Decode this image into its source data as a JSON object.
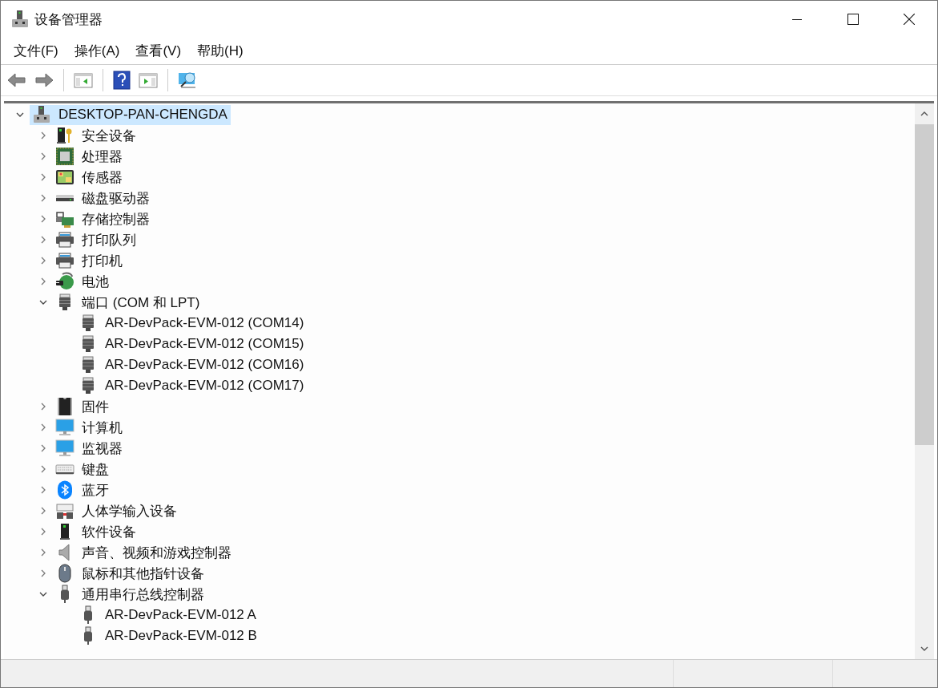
{
  "window": {
    "title": "设备管理器"
  },
  "menu": [
    {
      "label": "文件(F)"
    },
    {
      "label": "操作(A)"
    },
    {
      "label": "查看(V)"
    },
    {
      "label": "帮助(H)"
    }
  ],
  "toolbar": [
    {
      "kind": "back"
    },
    {
      "kind": "forward"
    },
    {
      "kind": "separator"
    },
    {
      "kind": "console_tree"
    },
    {
      "kind": "separator"
    },
    {
      "kind": "help"
    },
    {
      "kind": "action_pane"
    },
    {
      "kind": "separator"
    },
    {
      "kind": "scan"
    }
  ],
  "tree": [
    {
      "label": "DESKTOP-PAN-CHENGDA",
      "kind": "computer",
      "selected": true,
      "expanded": true,
      "children": [
        {
          "label": "安全设备",
          "kind": "security",
          "selected": false,
          "expanded": false
        },
        {
          "label": "处理器",
          "kind": "cpu",
          "selected": false,
          "expanded": false
        },
        {
          "label": "传感器",
          "kind": "sensor",
          "selected": false,
          "expanded": false
        },
        {
          "label": "磁盘驱动器",
          "kind": "disk",
          "selected": false,
          "expanded": false
        },
        {
          "label": "存储控制器",
          "kind": "storage",
          "selected": false,
          "expanded": false
        },
        {
          "label": "打印队列",
          "kind": "printer",
          "selected": false,
          "expanded": false
        },
        {
          "label": "打印机",
          "kind": "printer",
          "selected": false,
          "expanded": false
        },
        {
          "label": "电池",
          "kind": "battery",
          "selected": false,
          "expanded": false
        },
        {
          "label": "端口 (COM 和 LPT)",
          "kind": "port",
          "selected": false,
          "expanded": true,
          "children": [
            {
              "label": "AR-DevPack-EVM-012 (COM14)",
              "kind": "port",
              "selected": false
            },
            {
              "label": "AR-DevPack-EVM-012 (COM15)",
              "kind": "port",
              "selected": false
            },
            {
              "label": "AR-DevPack-EVM-012 (COM16)",
              "kind": "port",
              "selected": false
            },
            {
              "label": "AR-DevPack-EVM-012 (COM17)",
              "kind": "port",
              "selected": false
            }
          ]
        },
        {
          "label": "固件",
          "kind": "firmware",
          "selected": false,
          "expanded": false
        },
        {
          "label": "计算机",
          "kind": "monitor",
          "selected": false,
          "expanded": false
        },
        {
          "label": "监视器",
          "kind": "monitor",
          "selected": false,
          "expanded": false
        },
        {
          "label": "键盘",
          "kind": "keyboard",
          "selected": false,
          "expanded": false
        },
        {
          "label": "蓝牙",
          "kind": "bluetooth",
          "selected": false,
          "expanded": false
        },
        {
          "label": "人体学输入设备",
          "kind": "hid",
          "selected": false,
          "expanded": false
        },
        {
          "label": "软件设备",
          "kind": "software",
          "selected": false,
          "expanded": false
        },
        {
          "label": "声音、视频和游戏控制器",
          "kind": "speaker",
          "selected": false,
          "expanded": false
        },
        {
          "label": "鼠标和其他指针设备",
          "kind": "mouse",
          "selected": false,
          "expanded": false
        },
        {
          "label": "通用串行总线控制器",
          "kind": "usb",
          "selected": false,
          "expanded": true,
          "children": [
            {
              "label": "AR-DevPack-EVM-012 A",
              "kind": "usb",
              "selected": false
            },
            {
              "label": "AR-DevPack-EVM-012 B",
              "kind": "usb",
              "selected": false
            }
          ]
        }
      ]
    }
  ]
}
